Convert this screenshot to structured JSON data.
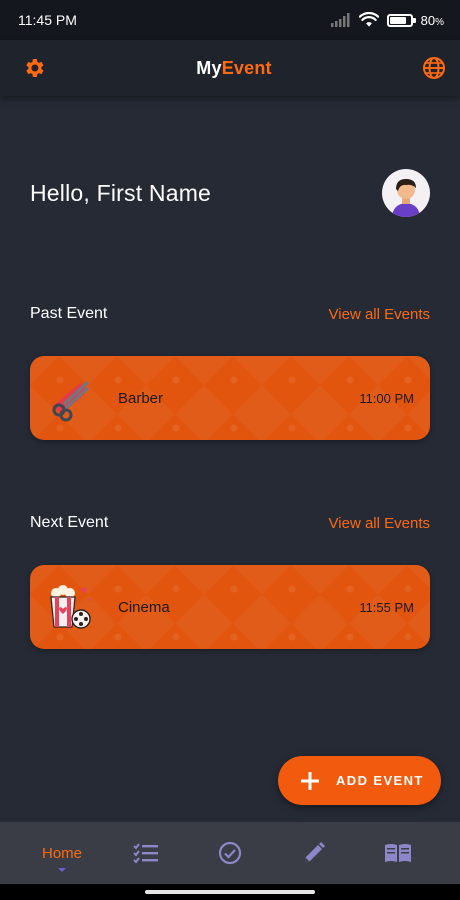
{
  "status_bar": {
    "time": "11:45 PM",
    "battery_level": 0.8,
    "battery_text": "80"
  },
  "app_bar": {
    "title_part1": "My",
    "title_part2": "Event",
    "left_icon": "gear-icon",
    "right_icon": "globe-icon"
  },
  "greeting": {
    "text": "Hello, First Name",
    "avatar": "avatar-icon"
  },
  "past": {
    "title": "Past Event",
    "view_all": "View all Events",
    "card": {
      "icon": "scissors-comb-icon",
      "name": "Barber",
      "time": "11:00 PM"
    }
  },
  "next": {
    "title": "Next Event",
    "view_all": "View all Events",
    "card": {
      "icon": "popcorn-film-icon",
      "name": "Cinema",
      "time": "11:55 PM"
    }
  },
  "fab": {
    "label": "ADD EVENT",
    "icon": "plus-icon"
  },
  "bottom_nav": {
    "items": [
      {
        "label": "Home",
        "active": true
      },
      {
        "icon": "checklist-icon"
      },
      {
        "icon": "check-circle-icon"
      },
      {
        "icon": "pencil-icon"
      },
      {
        "icon": "book-icon"
      }
    ]
  },
  "colors": {
    "accent": "#ff6a10",
    "card": "#e1550f",
    "background": "#252a35",
    "nav_icon": "#8d86c9"
  }
}
